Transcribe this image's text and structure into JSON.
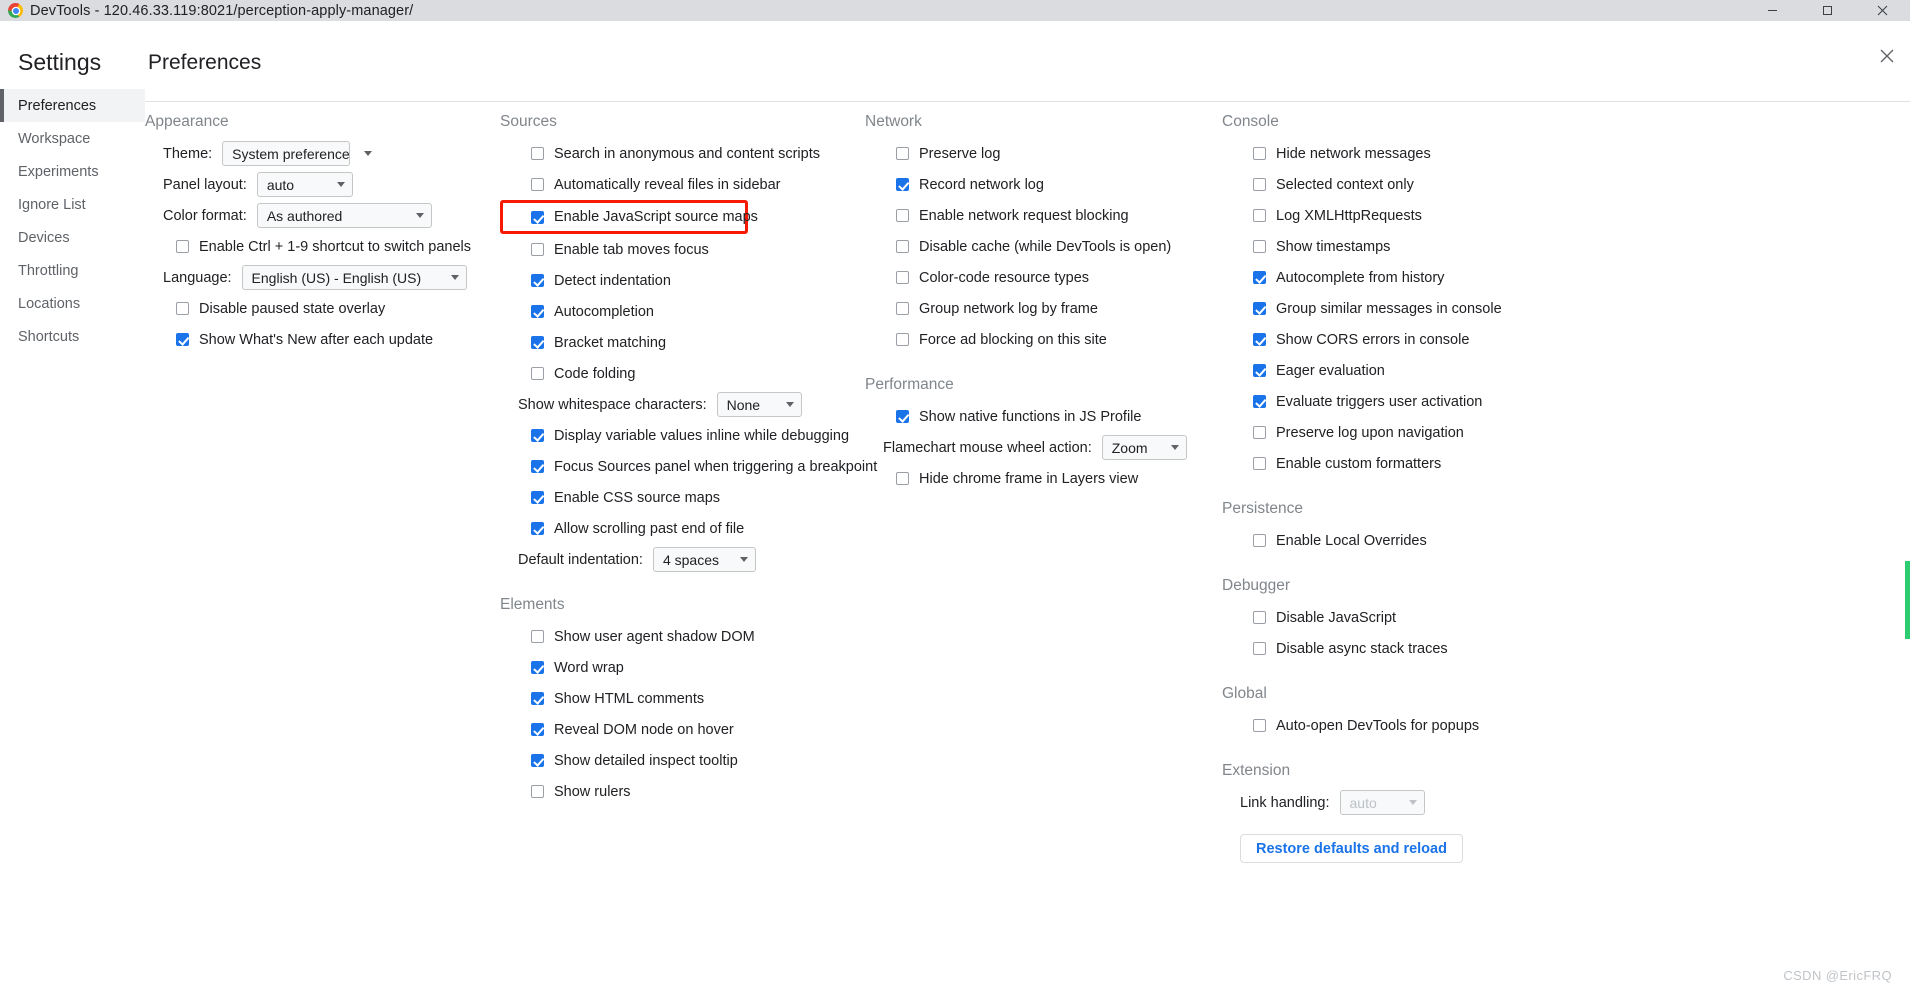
{
  "window": {
    "title": "DevTools - 120.46.33.119:8021/perception-apply-manager/",
    "logo_icon": "chrome-logo-icon",
    "minimize_icon": "minimize-icon",
    "maximize_icon": "maximize-icon",
    "close_icon": "close-icon"
  },
  "sidebar": {
    "title": "Settings",
    "items": [
      {
        "label": "Preferences",
        "active": true
      },
      {
        "label": "Workspace",
        "active": false
      },
      {
        "label": "Experiments",
        "active": false
      },
      {
        "label": "Ignore List",
        "active": false
      },
      {
        "label": "Devices",
        "active": false
      },
      {
        "label": "Throttling",
        "active": false
      },
      {
        "label": "Locations",
        "active": false
      },
      {
        "label": "Shortcuts",
        "active": false
      }
    ]
  },
  "header": {
    "page_title": "Preferences",
    "dialog_close_icon": "close-icon"
  },
  "colors": {
    "accent": "#1a73e8",
    "highlight_box": "#f81902",
    "section_heading": "#80868b",
    "titlebar_bg": "#dadce0",
    "scroll_marker": "#2ecc71"
  },
  "sections": {
    "appearance": {
      "title": "Appearance",
      "theme_label": "Theme:",
      "theme_value": "System preference",
      "panel_layout_label": "Panel layout:",
      "panel_layout_value": "auto",
      "color_format_label": "Color format:",
      "color_format_value": "As authored",
      "ctrl_shortcut_label": "Enable Ctrl + 1-9 shortcut to switch panels",
      "ctrl_shortcut_checked": false,
      "language_label": "Language:",
      "language_value": "English (US) - English (US)",
      "disable_paused_label": "Disable paused state overlay",
      "disable_paused_checked": false,
      "whats_new_label": "Show What's New after each update",
      "whats_new_checked": true
    },
    "sources": {
      "title": "Sources",
      "checkboxes_top": [
        {
          "label": "Search in anonymous and content scripts",
          "checked": false,
          "highlighted": false
        },
        {
          "label": "Automatically reveal files in sidebar",
          "checked": false,
          "highlighted": false
        },
        {
          "label": "Enable JavaScript source maps",
          "checked": true,
          "highlighted": true
        },
        {
          "label": "Enable tab moves focus",
          "checked": false,
          "highlighted": false
        },
        {
          "label": "Detect indentation",
          "checked": true,
          "highlighted": false
        },
        {
          "label": "Autocompletion",
          "checked": true,
          "highlighted": false
        },
        {
          "label": "Bracket matching",
          "checked": true,
          "highlighted": false
        },
        {
          "label": "Code folding",
          "checked": false,
          "highlighted": false
        }
      ],
      "whitespace_label": "Show whitespace characters:",
      "whitespace_value": "None",
      "checkboxes_mid": [
        {
          "label": "Display variable values inline while debugging",
          "checked": true
        },
        {
          "label": "Focus Sources panel when triggering a breakpoint",
          "checked": true
        },
        {
          "label": "Enable CSS source maps",
          "checked": true
        },
        {
          "label": "Allow scrolling past end of file",
          "checked": true
        }
      ],
      "indentation_label": "Default indentation:",
      "indentation_value": "4 spaces"
    },
    "elements": {
      "title": "Elements",
      "checkboxes": [
        {
          "label": "Show user agent shadow DOM",
          "checked": false
        },
        {
          "label": "Word wrap",
          "checked": true
        },
        {
          "label": "Show HTML comments",
          "checked": true
        },
        {
          "label": "Reveal DOM node on hover",
          "checked": true
        },
        {
          "label": "Show detailed inspect tooltip",
          "checked": true
        },
        {
          "label": "Show rulers",
          "checked": false
        }
      ]
    },
    "network": {
      "title": "Network",
      "checkboxes": [
        {
          "label": "Preserve log",
          "checked": false
        },
        {
          "label": "Record network log",
          "checked": true
        },
        {
          "label": "Enable network request blocking",
          "checked": false
        },
        {
          "label": "Disable cache (while DevTools is open)",
          "checked": false
        },
        {
          "label": "Color-code resource types",
          "checked": false
        },
        {
          "label": "Group network log by frame",
          "checked": false
        },
        {
          "label": "Force ad blocking on this site",
          "checked": false
        }
      ]
    },
    "performance": {
      "title": "Performance",
      "native_functions_label": "Show native functions in JS Profile",
      "native_functions_checked": true,
      "flamechart_label": "Flamechart mouse wheel action:",
      "flamechart_value": "Zoom",
      "hide_chrome_frame_label": "Hide chrome frame in Layers view",
      "hide_chrome_frame_checked": false
    },
    "console": {
      "title": "Console",
      "checkboxes": [
        {
          "label": "Hide network messages",
          "checked": false
        },
        {
          "label": "Selected context only",
          "checked": false
        },
        {
          "label": "Log XMLHttpRequests",
          "checked": false
        },
        {
          "label": "Show timestamps",
          "checked": false
        },
        {
          "label": "Autocomplete from history",
          "checked": true
        },
        {
          "label": "Group similar messages in console",
          "checked": true
        },
        {
          "label": "Show CORS errors in console",
          "checked": true
        },
        {
          "label": "Eager evaluation",
          "checked": true
        },
        {
          "label": "Evaluate triggers user activation",
          "checked": true
        },
        {
          "label": "Preserve log upon navigation",
          "checked": false
        },
        {
          "label": "Enable custom formatters",
          "checked": false
        }
      ]
    },
    "persistence": {
      "title": "Persistence",
      "checkboxes": [
        {
          "label": "Enable Local Overrides",
          "checked": false
        }
      ]
    },
    "debugger": {
      "title": "Debugger",
      "checkboxes": [
        {
          "label": "Disable JavaScript",
          "checked": false
        },
        {
          "label": "Disable async stack traces",
          "checked": false
        }
      ]
    },
    "global": {
      "title": "Global",
      "checkboxes": [
        {
          "label": "Auto-open DevTools for popups",
          "checked": false
        }
      ]
    },
    "extension": {
      "title": "Extension",
      "link_handling_label": "Link handling:",
      "link_handling_value": "auto",
      "restore_button_label": "Restore defaults and reload"
    }
  },
  "watermark": "CSDN @EricFRQ"
}
